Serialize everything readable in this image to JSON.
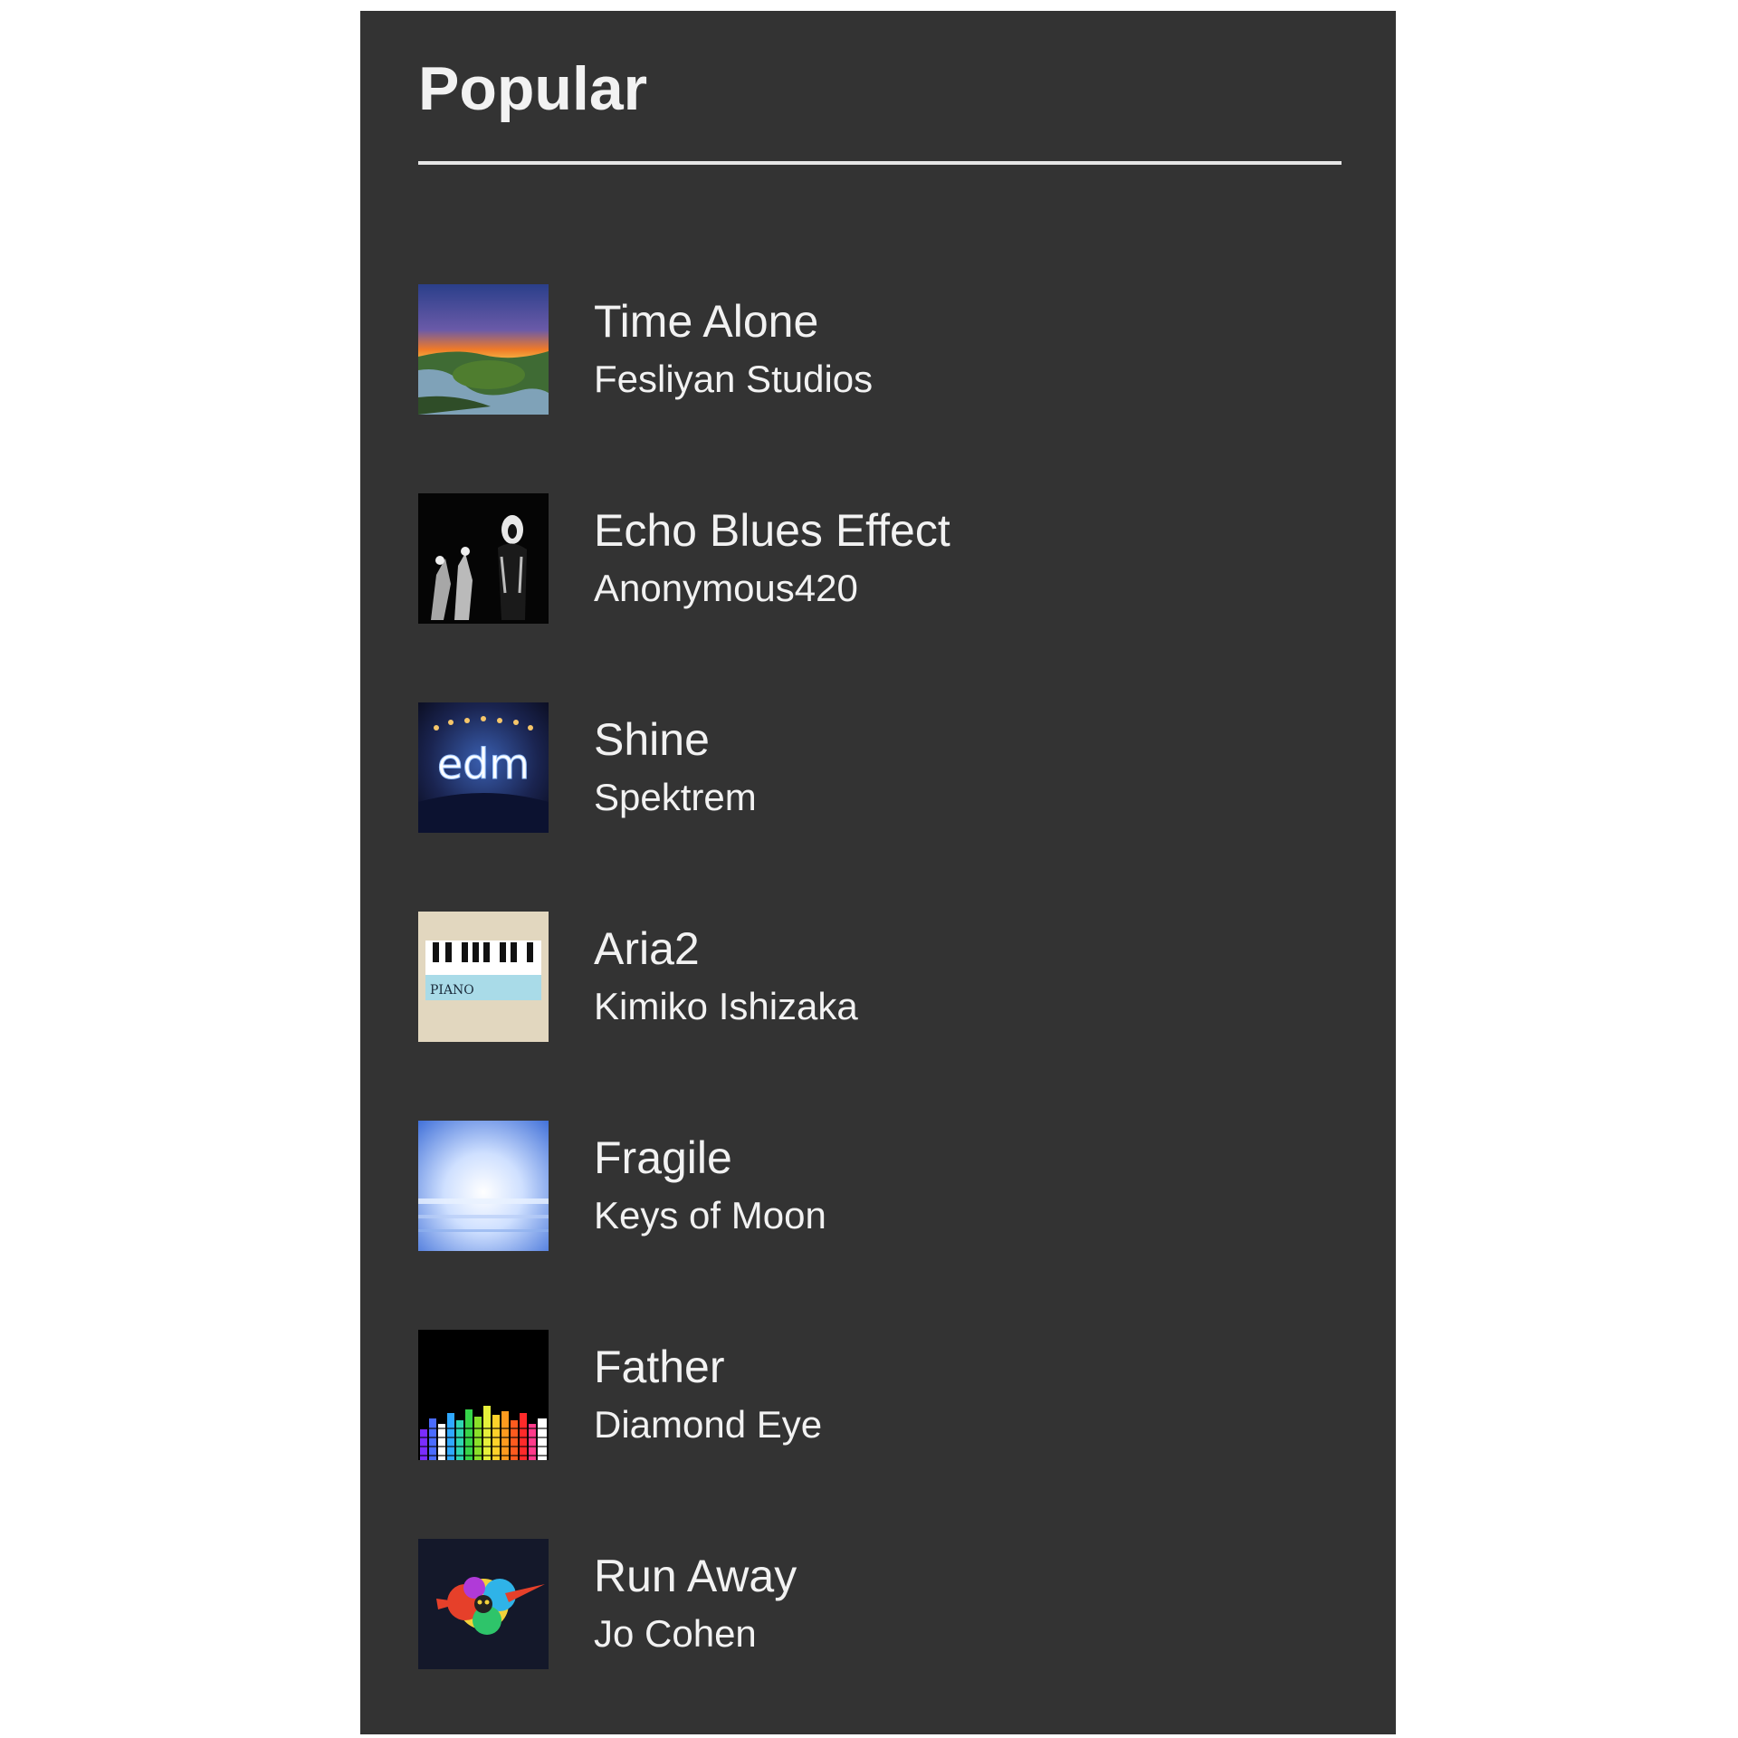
{
  "section": {
    "title": "Popular"
  },
  "tracks": [
    {
      "title": "Time Alone",
      "artist": "Fesliyan Studios",
      "art": "landscape-sunset-icon"
    },
    {
      "title": "Echo Blues Effect",
      "artist": "Anonymous420",
      "art": "dark-figures-icon"
    },
    {
      "title": "Shine",
      "artist": "Spektrem",
      "art": "edm-logo-icon",
      "art_text": "edm"
    },
    {
      "title": "Aria2",
      "artist": "Kimiko Ishizaka",
      "art": "piano-keys-icon",
      "art_text": "PIANO"
    },
    {
      "title": "Fragile",
      "artist": "Keys of Moon",
      "art": "misty-sea-icon"
    },
    {
      "title": "Father",
      "artist": "Diamond Eye",
      "art": "equalizer-bars-icon"
    },
    {
      "title": "Run Away",
      "artist": "Jo Cohen",
      "art": "paint-splash-icon"
    }
  ],
  "colors": {
    "panel_bg": "#333333",
    "text": "#f2f2f2",
    "rule": "#e6e6e6"
  }
}
